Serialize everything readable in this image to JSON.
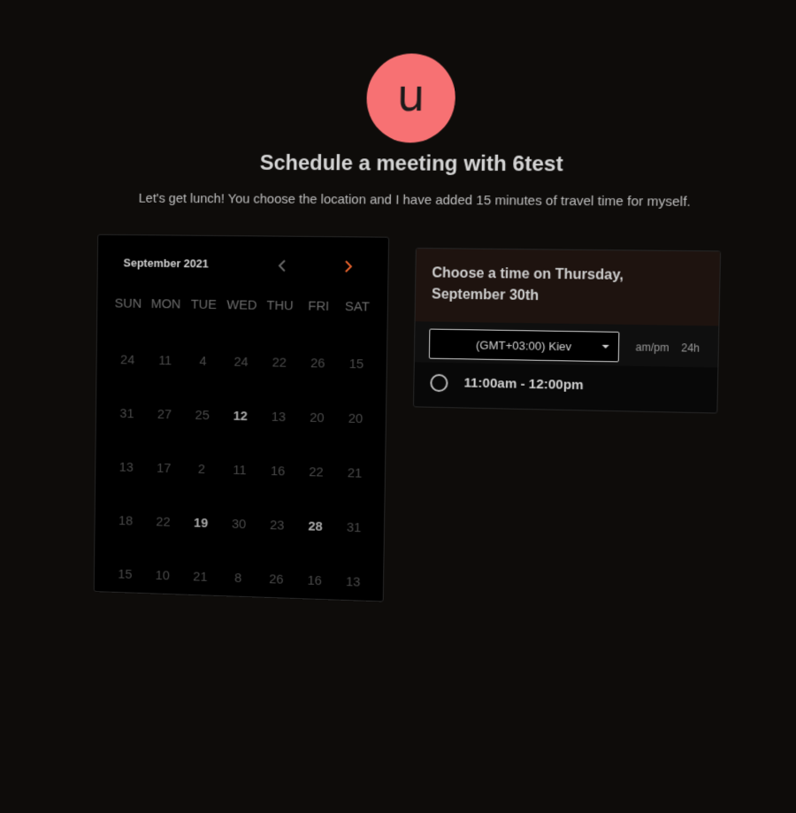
{
  "avatar": {
    "letter": "u",
    "color": "#f77173"
  },
  "title": "Schedule a meeting with 6test",
  "subtitle": "Let's get lunch! You choose the location and I have added 15 minutes of travel time for myself.",
  "calendar": {
    "month": "September 2021",
    "prev_icon": "chevron-left-icon",
    "next_icon": "chevron-right-icon",
    "accent": "#e8622c",
    "weekdays": [
      "SUN",
      "MON",
      "TUE",
      "WED",
      "THU",
      "FRI",
      "SAT"
    ],
    "weeks": [
      [
        {
          "d": "24",
          "a": false
        },
        {
          "d": "11",
          "a": false
        },
        {
          "d": "4",
          "a": false
        },
        {
          "d": "24",
          "a": false
        },
        {
          "d": "22",
          "a": false
        },
        {
          "d": "26",
          "a": false
        },
        {
          "d": "15",
          "a": false
        }
      ],
      [
        {
          "d": "31",
          "a": false
        },
        {
          "d": "27",
          "a": false
        },
        {
          "d": "25",
          "a": false
        },
        {
          "d": "12",
          "a": true
        },
        {
          "d": "13",
          "a": false
        },
        {
          "d": "20",
          "a": false
        },
        {
          "d": "20",
          "a": false
        }
      ],
      [
        {
          "d": "13",
          "a": false
        },
        {
          "d": "17",
          "a": false
        },
        {
          "d": "2",
          "a": false
        },
        {
          "d": "11",
          "a": false
        },
        {
          "d": "16",
          "a": false
        },
        {
          "d": "22",
          "a": false
        },
        {
          "d": "21",
          "a": false
        }
      ],
      [
        {
          "d": "18",
          "a": false
        },
        {
          "d": "22",
          "a": false
        },
        {
          "d": "19",
          "a": true
        },
        {
          "d": "30",
          "a": false
        },
        {
          "d": "23",
          "a": false
        },
        {
          "d": "28",
          "a": true
        },
        {
          "d": "31",
          "a": false
        }
      ],
      [
        {
          "d": "15",
          "a": false
        },
        {
          "d": "10",
          "a": false
        },
        {
          "d": "21",
          "a": false
        },
        {
          "d": "8",
          "a": false
        },
        {
          "d": "26",
          "a": false
        },
        {
          "d": "16",
          "a": false
        },
        {
          "d": "13",
          "a": false
        }
      ]
    ]
  },
  "time_panel": {
    "header_line1": "Choose a time on Thursday,",
    "header_line2": "September 30th",
    "timezone": "(GMT+03:00) Kiev",
    "format_ampm": "am/pm",
    "format_24h": "24h",
    "slots": [
      {
        "label": "11:00am - 12:00pm"
      }
    ]
  }
}
